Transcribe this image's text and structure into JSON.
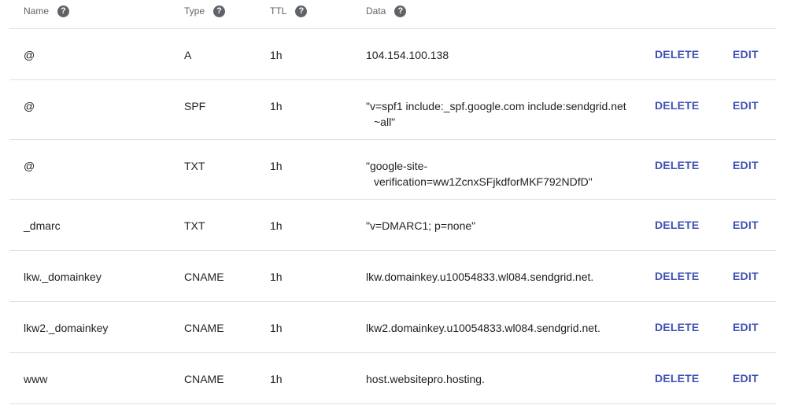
{
  "header": {
    "name": "Name",
    "type": "Type",
    "ttl": "TTL",
    "data": "Data",
    "help_glyph": "?"
  },
  "actions": {
    "delete": "DELETE",
    "edit": "EDIT"
  },
  "colors": {
    "action": "#3f51b5",
    "header_text": "#5f6368",
    "divider": "#e0e0e0"
  },
  "records": [
    {
      "name": "@",
      "type": "A",
      "ttl": "1h",
      "data1": "104.154.100.138",
      "data2": ""
    },
    {
      "name": "@",
      "type": "SPF",
      "ttl": "1h",
      "data1": "\"v=spf1 include:_spf.google.com include:sendgrid.net",
      "data2": "~all\""
    },
    {
      "name": "@",
      "type": "TXT",
      "ttl": "1h",
      "data1": "\"google-site-",
      "data2": "verification=ww1ZcnxSFjkdforMKF792NDfD\""
    },
    {
      "name": "_dmarc",
      "type": "TXT",
      "ttl": "1h",
      "data1": "\"v=DMARC1; p=none\"",
      "data2": ""
    },
    {
      "name": "lkw._domainkey",
      "type": "CNAME",
      "ttl": "1h",
      "data1": "lkw.domainkey.u10054833.wl084.sendgrid.net.",
      "data2": ""
    },
    {
      "name": "lkw2._domainkey",
      "type": "CNAME",
      "ttl": "1h",
      "data1": "lkw2.domainkey.u10054833.wl084.sendgrid.net.",
      "data2": ""
    },
    {
      "name": "www",
      "type": "CNAME",
      "ttl": "1h",
      "data1": "host.websitepro.hosting.",
      "data2": ""
    }
  ]
}
